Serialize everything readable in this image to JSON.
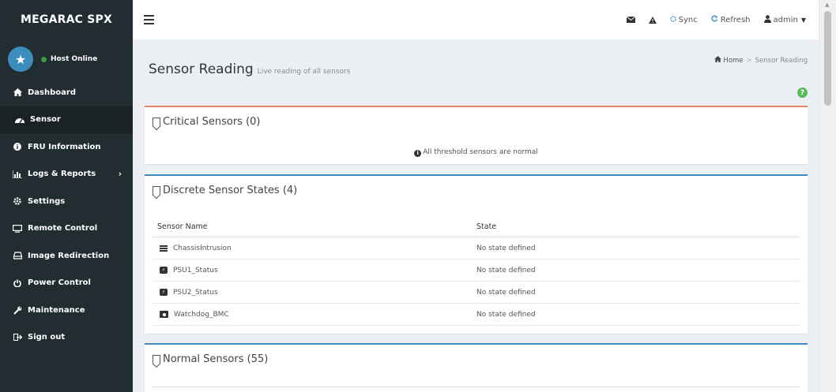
{
  "sidebar": {
    "brand": "MEGARAC SPX",
    "host_status": "Host Online",
    "items": [
      {
        "label": "Dashboard",
        "icon": "home-icon"
      },
      {
        "label": "Sensor",
        "icon": "gauge-icon"
      },
      {
        "label": "FRU Information",
        "icon": "info-icon"
      },
      {
        "label": "Logs & Reports",
        "icon": "bar-chart-icon"
      },
      {
        "label": "Settings",
        "icon": "gear-icon"
      },
      {
        "label": "Remote Control",
        "icon": "monitor-icon"
      },
      {
        "label": "Image Redirection",
        "icon": "disk-icon"
      },
      {
        "label": "Power Control",
        "icon": "power-icon"
      },
      {
        "label": "Maintenance",
        "icon": "wrench-icon"
      },
      {
        "label": "Sign out",
        "icon": "sign-out-icon"
      }
    ]
  },
  "topbar": {
    "sync_label": "Sync",
    "refresh_label": "Refresh",
    "user_label": "admin"
  },
  "page": {
    "title": "Sensor Reading",
    "subtitle": "Live reading of all sensors",
    "breadcrumb_home": "Home",
    "breadcrumb_current": "Sensor Reading"
  },
  "critical": {
    "title": "Critical Sensors (0)",
    "message": "All threshold sensors are normal"
  },
  "discrete": {
    "title": "Discrete Sensor States (4)",
    "columns": [
      "Sensor Name",
      "State"
    ],
    "rows": [
      {
        "name": "ChassisIntrusion",
        "state": "No state defined",
        "icon": "list-icon"
      },
      {
        "name": "PSU1_Status",
        "state": "No state defined",
        "icon": "psu-icon"
      },
      {
        "name": "PSU2_Status",
        "state": "No state defined",
        "icon": "psu-icon"
      },
      {
        "name": "Watchdog_BMC",
        "state": "No state defined",
        "icon": "watchdog-icon"
      }
    ]
  },
  "normal": {
    "title": "Normal Sensors (55)"
  },
  "colors": {
    "sidebar_bg": "#222d32",
    "accent": "#3c8dbc",
    "critical_border": "#e0856a",
    "online": "#3c9b3c"
  }
}
